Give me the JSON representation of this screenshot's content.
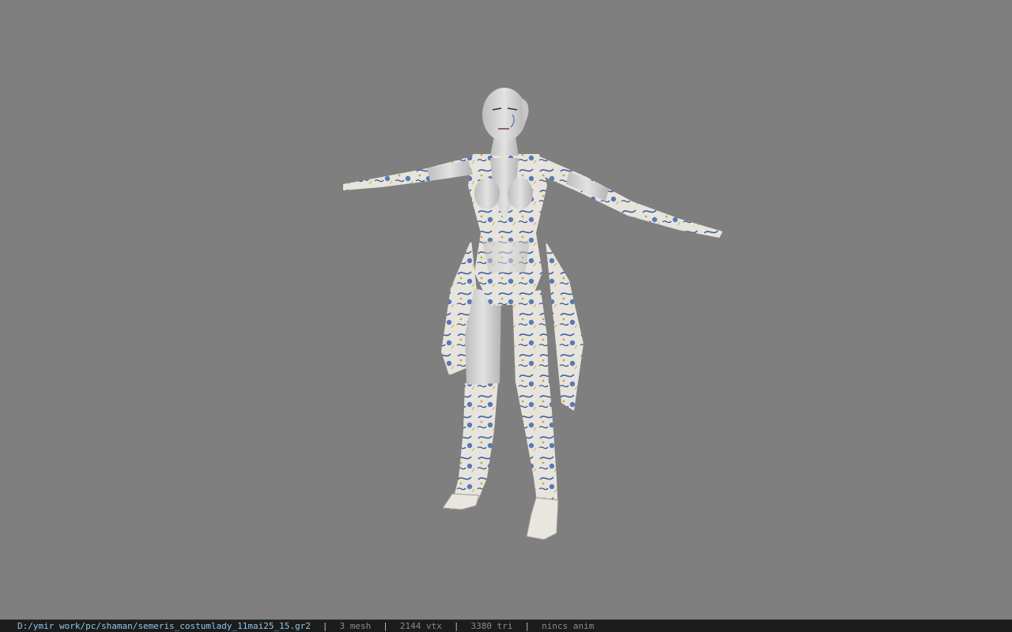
{
  "status": {
    "file_path": "D:/ymir work/pc/shaman/semeris_costumlady_11mai25_15.gr2",
    "separator": "|",
    "mesh_count": "3 mesh",
    "vertex_count": "2144 vtx",
    "triangle_count": "3380 tri",
    "animation": "nincs anim"
  },
  "viewport": {
    "background_color": "#7f7f7f",
    "model_icon": "character-model-tpose"
  },
  "colors": {
    "path_text": "#8fc6ea",
    "status_text": "#8a8a8a",
    "statusbar_bg": "#1c1c1c",
    "skin": "#d8d8d8",
    "pattern": "#3d5c9e"
  }
}
